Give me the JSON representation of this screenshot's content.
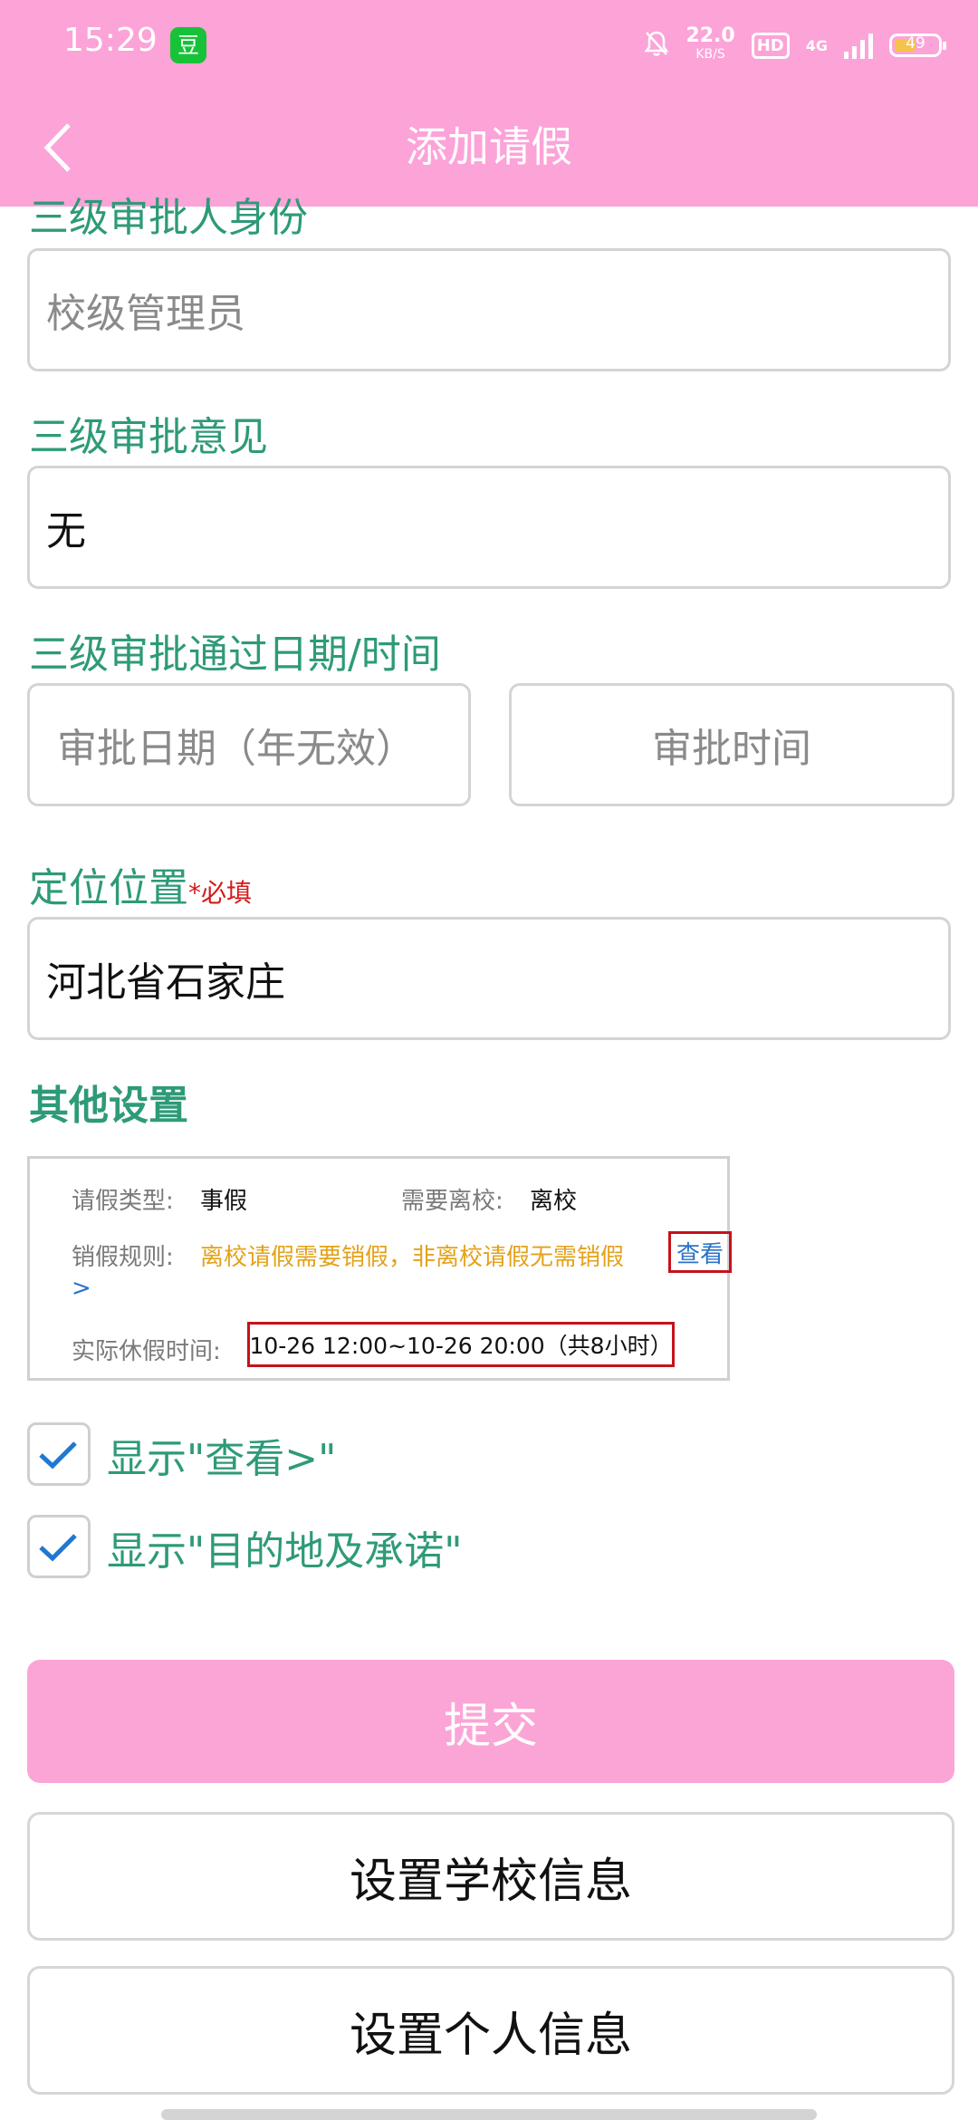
{
  "status_bar": {
    "time": "15:29",
    "app_badge": "豆",
    "speed_value": "22.0",
    "speed_unit": "KB/S",
    "hd": "HD",
    "network": "4G",
    "battery": "49"
  },
  "header": {
    "title": "添加请假",
    "background_color": "#fca3d8"
  },
  "form": {
    "level3_identity_label": "三级审批人身份",
    "level3_identity_placeholder": "校级管理员",
    "level3_opinion_label": "三级审批意见",
    "level3_opinion_value": "无",
    "level3_datetime_label": "三级审批通过日期/时间",
    "approval_date_placeholder": "审批日期（年无效）",
    "approval_time_placeholder": "审批时间",
    "location_label": "定位位置",
    "location_required": "*必填",
    "location_value": "河北省石家庄",
    "other_settings_label": "其他设置"
  },
  "preview": {
    "leave_type_label": "请假类型:",
    "leave_type_value": "事假",
    "leave_school_label": "需要离校:",
    "leave_school_value": "离校",
    "cancel_rule_label": "销假规则:",
    "cancel_rule_value": "离校请假需要销假，非离校请假无需销假",
    "view_link": "查看",
    "view_arrow": ">",
    "actual_time_label": "实际休假时间:",
    "actual_time_value": "10-26 12:00~10-26 20:00（共8小时）"
  },
  "options": [
    {
      "label": "显示\"查看>\"",
      "checked": true
    },
    {
      "label": "显示\"目的地及承诺\"",
      "checked": true
    }
  ],
  "buttons": {
    "submit": "提交",
    "school_info": "设置学校信息",
    "personal_info": "设置个人信息"
  },
  "colors": {
    "accent_pink": "#fca3d8",
    "label_green": "#2e9a78",
    "required_red": "#d41a1a",
    "checkbox_blue": "#1f78d1"
  }
}
